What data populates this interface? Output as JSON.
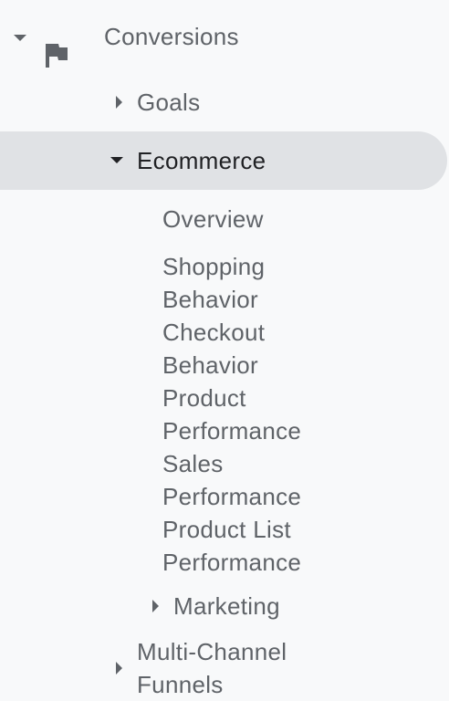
{
  "nav": {
    "conversions": {
      "label": "Conversions",
      "icon": "flag-icon",
      "expanded": true
    },
    "goals": {
      "label": "Goals",
      "expanded": false
    },
    "ecommerce": {
      "label": "Ecommerce",
      "expanded": true,
      "selected": true,
      "items": [
        {
          "label": "Overview"
        },
        {
          "label": "Shopping Behavior"
        },
        {
          "label": "Checkout Behavior"
        },
        {
          "label": "Product Performance"
        },
        {
          "label": "Sales Performance"
        },
        {
          "label": "Product List Performance"
        }
      ],
      "marketing": {
        "label": "Marketing",
        "expanded": false
      }
    },
    "multi_channel_funnels": {
      "label": "Multi-Channel Funnels",
      "expanded": false
    }
  },
  "colors": {
    "background": "#f8f9fa",
    "text": "#5f6368",
    "active_text": "#202124",
    "active_background": "#e0e2e5"
  }
}
